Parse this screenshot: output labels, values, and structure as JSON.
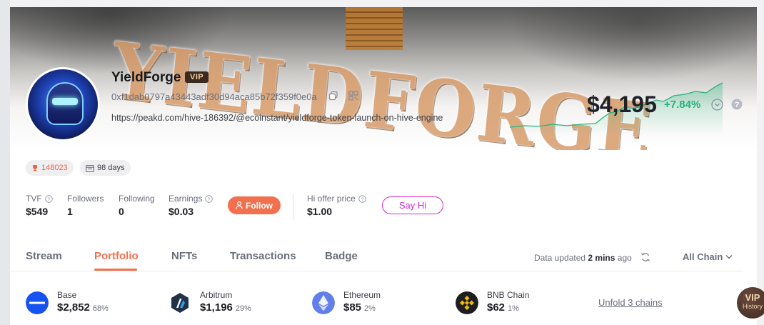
{
  "profile": {
    "banner_text": "YIELDFORGE",
    "name": "YieldForge",
    "vip_badge": "VIP",
    "address": "0xf1dab0797a43443adf30d94aca85b72f359f0e0a",
    "link": "https://peakd.com/hive-186392/@ecoinstant/yieldforge-token-launch-on-hive-engine",
    "rank": "148023",
    "days": "98 days"
  },
  "portfolio": {
    "value": "$4,195",
    "change": "+7.84%",
    "change_color": "#27b37c"
  },
  "stats": {
    "tvf_label": "TVF",
    "tvf_value": "$549",
    "followers_label": "Followers",
    "followers_value": "1",
    "following_label": "Following",
    "following_value": "0",
    "earnings_label": "Earnings",
    "earnings_value": "$0.03",
    "follow_label": "Follow",
    "hi_offer_label": "Hi offer price",
    "hi_offer_value": "$1.00",
    "say_hi_label": "Say Hi"
  },
  "tabs": [
    {
      "label": "Stream"
    },
    {
      "label": "Portfolio",
      "active": true
    },
    {
      "label": "NFTs"
    },
    {
      "label": "Transactions"
    },
    {
      "label": "Badge"
    }
  ],
  "status": {
    "updated_prefix": "Data updated",
    "updated_time": "2 mins",
    "updated_suffix": "ago",
    "chain_filter": "All Chain"
  },
  "chains": [
    {
      "name": "Base",
      "value": "$2,852",
      "pct": "68%",
      "icon": "base-icon",
      "color": "#1652f0"
    },
    {
      "name": "Arbitrum",
      "value": "$1,196",
      "pct": "29%",
      "icon": "arbitrum-icon",
      "color": "#213147"
    },
    {
      "name": "Ethereum",
      "value": "$85",
      "pct": "2%",
      "icon": "ethereum-icon",
      "color": "#627eea"
    },
    {
      "name": "BNB Chain",
      "value": "$62",
      "pct": "1%",
      "icon": "bnb-icon",
      "color": "#f0b90b"
    }
  ],
  "unfold_label": "Unfold 3 chains",
  "vip_float": {
    "title": "VIP",
    "subtitle": "History"
  },
  "colors": {
    "accent": "#f2704e",
    "sayhi": "#d62bd6"
  }
}
